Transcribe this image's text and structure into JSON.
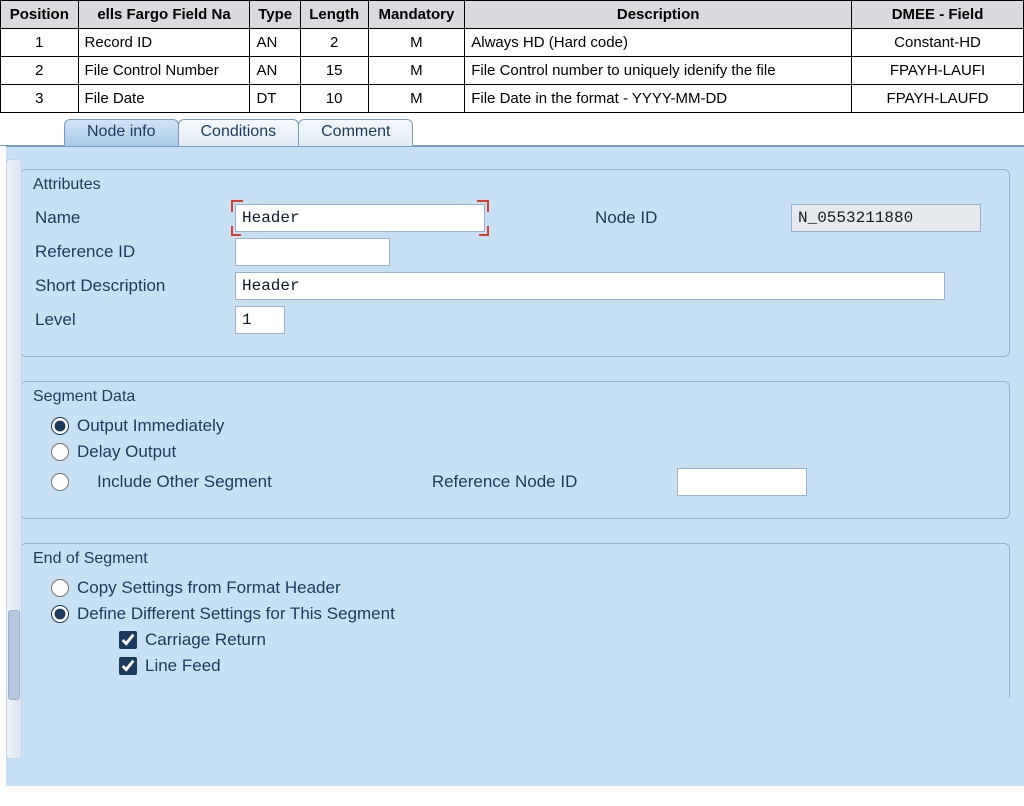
{
  "columns": {
    "position": "Position",
    "fieldname": "ells Fargo Field Na",
    "type": "Type",
    "length": "Length",
    "mandatory": "Mandatory",
    "description": "Description",
    "dmee": "DMEE - Field"
  },
  "rows": [
    {
      "position": "1",
      "fieldname": "Record ID",
      "type": "AN",
      "length": "2",
      "mandatory": "M",
      "description": "Always HD (Hard code)",
      "dmee": "Constant-HD"
    },
    {
      "position": "2",
      "fieldname": "File Control Number",
      "type": "AN",
      "length": "15",
      "mandatory": "M",
      "description": "File Control number to uniquely idenify the file",
      "dmee": "FPAYH-LAUFI"
    },
    {
      "position": "3",
      "fieldname": "File Date",
      "type": "DT",
      "length": "10",
      "mandatory": "M",
      "description": "File Date in the format - YYYY-MM-DD",
      "dmee": "FPAYH-LAUFD"
    }
  ],
  "tabs": {
    "t1": "Node info",
    "t2": "Conditions",
    "t3": "Comment"
  },
  "attributes": {
    "group_title": "Attributes",
    "name_label": "Name",
    "name_value": "Header",
    "nodeid_label": "Node ID",
    "nodeid_value": "N_0553211880",
    "refid_label": "Reference ID",
    "refid_value": "",
    "shortdesc_label": "Short Description",
    "shortdesc_value": "Header",
    "level_label": "Level",
    "level_value": "1"
  },
  "segment": {
    "group_title": "Segment Data",
    "opt1": "Output Immediately",
    "opt2": "Delay Output",
    "opt3": "Include Other Segment",
    "refnodeid_label": "Reference Node ID",
    "refnodeid_value": ""
  },
  "endseg": {
    "group_title": "End of Segment",
    "opt1": "Copy Settings from Format Header",
    "opt2": "Define Different Settings for This Segment",
    "chk1": "Carriage Return",
    "chk2": "Line Feed"
  }
}
